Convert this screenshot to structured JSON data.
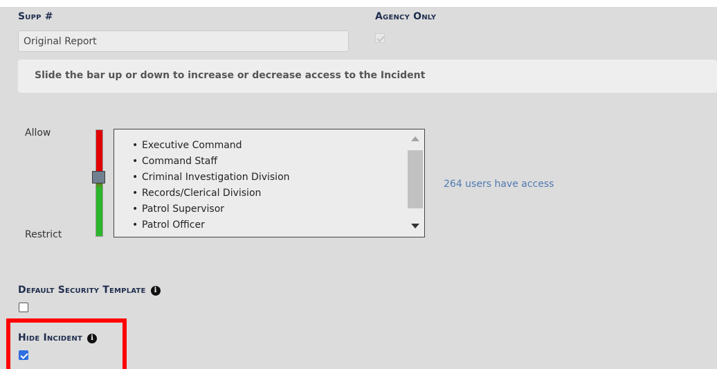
{
  "form": {
    "supp_label": "Supp #",
    "supp_value": "Original Report",
    "agency_only_label": "Agency Only",
    "agency_only_checked": true,
    "banner_text": "Slide the bar up or down to increase or decrease access to the Incident",
    "slider": {
      "top_label": "Allow",
      "bottom_label": "Restrict",
      "colors": {
        "allow": "#e00000",
        "restrict": "#2bb52b",
        "handle": "#708090"
      }
    },
    "groups": [
      "Executive Command",
      "Command Staff",
      "Criminal Investigation Division",
      "Records/Clerical Division",
      "Patrol Supervisor",
      "Patrol Officer"
    ],
    "access_text": "264 users have access",
    "default_template_label": "Default Security Template",
    "default_template_checked": false,
    "hide_incident_label": "Hide Incident",
    "hide_incident_checked": true,
    "info_icon": "i"
  },
  "colors": {
    "label": "#1f2d4d",
    "link": "#4f79b0",
    "highlight": "#ff0000",
    "checkbox": "#2f6fe0"
  }
}
